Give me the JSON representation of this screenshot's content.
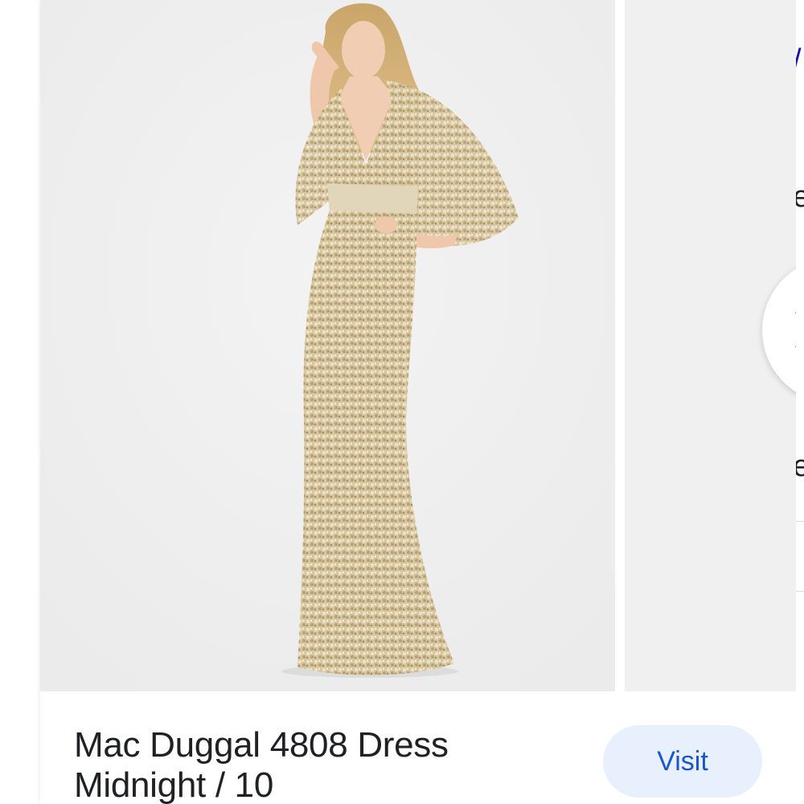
{
  "product": {
    "title_line1": "Mac Duggal 4808 Dress",
    "title_line2": "Midnight / 10"
  },
  "actions": {
    "visit_label": "Visit"
  },
  "carousel": {
    "next_icon": "chevron-right-icon"
  },
  "peek": {
    "glyph1": "/",
    "glyph2": "e",
    "glyph3": "e"
  },
  "colors": {
    "visit_bg": "#e8f0fe",
    "visit_text": "#1a57c9",
    "title_text": "#202124",
    "dress_gold": "#d8c8a4"
  }
}
